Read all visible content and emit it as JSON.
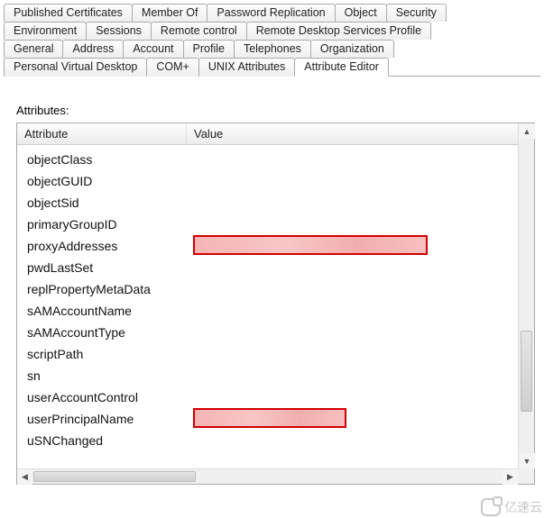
{
  "tabs": {
    "r1": [
      "Published Certificates",
      "Member Of",
      "Password Replication",
      "Object",
      "Security"
    ],
    "r2": [
      "Environment",
      "Sessions",
      "Remote control",
      "Remote Desktop Services Profile"
    ],
    "r3": [
      "General",
      "Address",
      "Account",
      "Profile",
      "Telephones",
      "Organization"
    ],
    "r4": [
      "Personal Virtual Desktop",
      "COM+",
      "UNIX Attributes",
      "Attribute Editor"
    ]
  },
  "activeTab": "Attribute Editor",
  "listLabel": "Attributes:",
  "columns": {
    "attr": "Attribute",
    "val": "Value"
  },
  "attributes": [
    {
      "name": "objectClass",
      "value": ""
    },
    {
      "name": "objectGUID",
      "value": ""
    },
    {
      "name": "objectSid",
      "value": ""
    },
    {
      "name": "primaryGroupID",
      "value": ""
    },
    {
      "name": "proxyAddresses",
      "value": "",
      "redacted": true,
      "redactWidth": 260
    },
    {
      "name": "pwdLastSet",
      "value": ""
    },
    {
      "name": "replPropertyMetaData",
      "value": ""
    },
    {
      "name": "sAMAccountName",
      "value": ""
    },
    {
      "name": "sAMAccountType",
      "value": ""
    },
    {
      "name": "scriptPath",
      "value": ""
    },
    {
      "name": "sn",
      "value": ""
    },
    {
      "name": "userAccountControl",
      "value": ""
    },
    {
      "name": "userPrincipalName",
      "value": "",
      "redacted": true,
      "redactWidth": 170
    },
    {
      "name": "uSNChanged",
      "value": ""
    }
  ],
  "watermark": "亿速云"
}
